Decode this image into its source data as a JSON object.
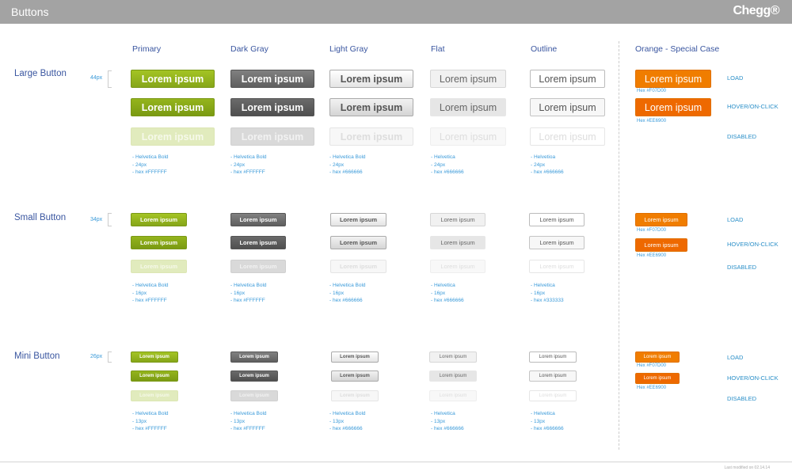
{
  "header": {
    "title": "Buttons",
    "logo": "Chegg®"
  },
  "columns": {
    "primary": "Primary",
    "dark_gray": "Dark Gray",
    "light_gray": "Light Gray",
    "flat": "Flat",
    "outline": "Outline",
    "orange": "Orange - Special Case"
  },
  "button_label": "Lorem ipsum",
  "sections": {
    "large": {
      "title": "Large Button",
      "size": "44px",
      "specs": {
        "primary": [
          "- Helvetica Bold",
          "- 24px",
          "- hex #FFFFFF"
        ],
        "dark_gray": [
          "- Helvetica Bold",
          "- 24px",
          "- hex #FFFFFF"
        ],
        "light_gray": [
          "- Helvetica Bold",
          "- 24px",
          "- hex #666666"
        ],
        "flat": [
          "- Helvetica",
          "- 24px",
          "- hex #666666"
        ],
        "outline": [
          "- Helvetioa",
          "- 24px",
          "- hex #666666"
        ]
      }
    },
    "small": {
      "title": "Small Button",
      "size": "34px",
      "specs": {
        "primary": [
          "- Helvetica Bold",
          "- 16px",
          "- hex #FFFFFF"
        ],
        "dark_gray": [
          "- Helvetica Bold",
          "- 16px",
          "- hex #FFFFFF"
        ],
        "light_gray": [
          "- Helvetica Bold",
          "- 16px",
          "- hex #666666"
        ],
        "flat": [
          "- Helvetica",
          "- 16px",
          "- hex #666666"
        ],
        "outline": [
          "- Helvetica",
          "- 16px",
          "- hex #333333"
        ]
      }
    },
    "mini": {
      "title": "Mini Button",
      "size": "26px",
      "specs": {
        "primary": [
          "- Helvetica Bold",
          "- 13px",
          "- hex #FFFFFF"
        ],
        "dark_gray": [
          "- Helvetica Bold",
          "- 13px",
          "- hex #FFFFFF"
        ],
        "light_gray": [
          "- Helvetica Bold",
          "- 13px",
          "- hex #666666"
        ],
        "flat": [
          "- Helvetica",
          "- 13px",
          "- hex #666666"
        ],
        "outline": [
          "- Helvetica",
          "- 13px",
          "- hex #666666"
        ]
      }
    }
  },
  "orange_hex": {
    "load": "Hex #F07D00",
    "hover": "Hex #EE6900"
  },
  "states": {
    "load": "LOAD",
    "hover": "HOVER/ON-CLICK",
    "disabled": "DISABLED"
  },
  "colors": {
    "primary": "#8DAD1C",
    "dark_gray": "#6F6F6F",
    "orange_load": "#F07D00",
    "orange_hover": "#EE6900",
    "heading": "#3A56A0",
    "spec_text": "#3A9AD9"
  },
  "footer": "Last modified on 02.14.14"
}
